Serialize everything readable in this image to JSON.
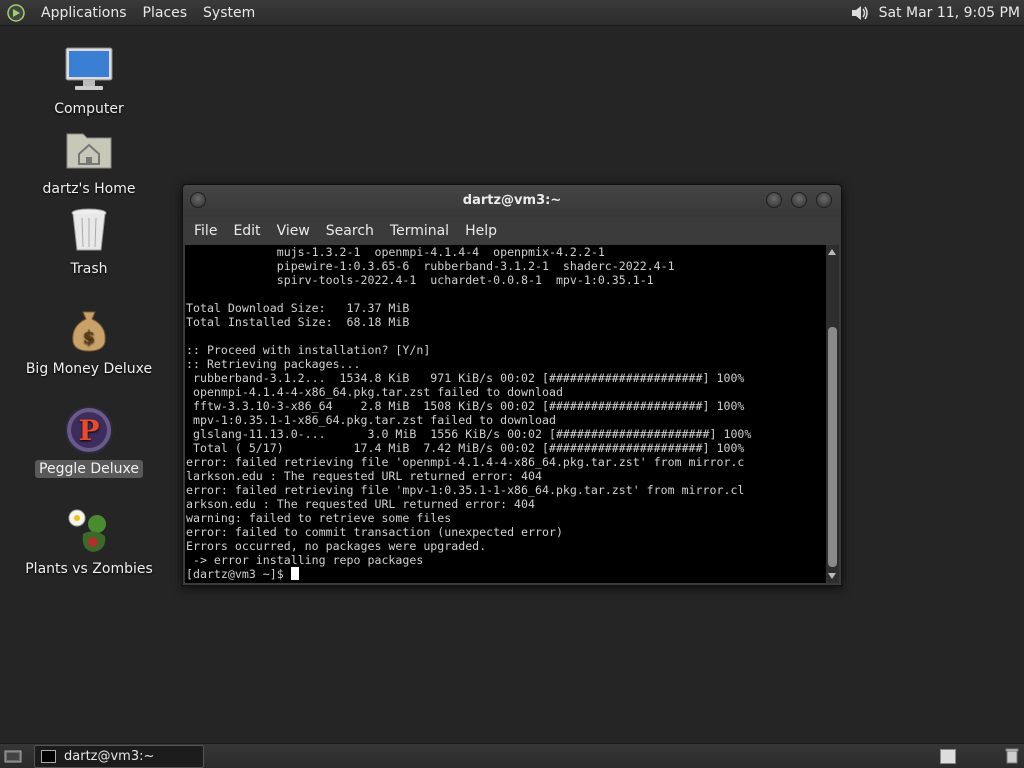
{
  "top_panel": {
    "menus": [
      "Applications",
      "Places",
      "System"
    ],
    "clock": "Sat Mar 11,  9:05 PM"
  },
  "desktop_icons": [
    {
      "label": "Computer",
      "icon": "computer-icon"
    },
    {
      "label": "dartz's Home",
      "icon": "home-folder-icon"
    },
    {
      "label": "Trash",
      "icon": "trash-icon"
    },
    {
      "label": "Big Money Deluxe",
      "icon": "money-bag-icon"
    },
    {
      "label": "Peggle Deluxe",
      "icon": "peggle-icon"
    },
    {
      "label": "Plants vs Zombies",
      "icon": "plants-zombies-icon"
    }
  ],
  "terminal": {
    "title": "dartz@vm3:~",
    "menu": [
      "File",
      "Edit",
      "View",
      "Search",
      "Terminal",
      "Help"
    ],
    "lines": [
      "             mujs-1.3.2-1  openmpi-4.1.4-4  openpmix-4.2.2-1",
      "             pipewire-1:0.3.65-6  rubberband-3.1.2-1  shaderc-2022.4-1",
      "             spirv-tools-2022.4-1  uchardet-0.0.8-1  mpv-1:0.35.1-1",
      "",
      "Total Download Size:   17.37 MiB",
      "Total Installed Size:  68.18 MiB",
      "",
      ":: Proceed with installation? [Y/n]",
      ":: Retrieving packages...",
      " rubberband-3.1.2...  1534.8 KiB   971 KiB/s 00:02 [######################] 100%",
      " openmpi-4.1.4-4-x86_64.pkg.tar.zst failed to download",
      " fftw-3.3.10-3-x86_64    2.8 MiB  1508 KiB/s 00:02 [######################] 100%",
      " mpv-1:0.35.1-1-x86_64.pkg.tar.zst failed to download",
      " glslang-11.13.0-...      3.0 MiB  1556 KiB/s 00:02 [######################] 100%",
      " Total ( 5/17)          17.4 MiB  7.42 MiB/s 00:02 [######################] 100%",
      "error: failed retrieving file 'openmpi-4.1.4-4-x86_64.pkg.tar.zst' from mirror.c",
      "larkson.edu : The requested URL returned error: 404",
      "error: failed retrieving file 'mpv-1:0.35.1-1-x86_64.pkg.tar.zst' from mirror.cl",
      "arkson.edu : The requested URL returned error: 404",
      "warning: failed to retrieve some files",
      "error: failed to commit transaction (unexpected error)",
      "Errors occurred, no packages were upgraded.",
      " -> error installing repo packages"
    ],
    "prompt": "[dartz@vm3 ~]$ "
  },
  "bottom_panel": {
    "task_label": "dartz@vm3:~"
  }
}
